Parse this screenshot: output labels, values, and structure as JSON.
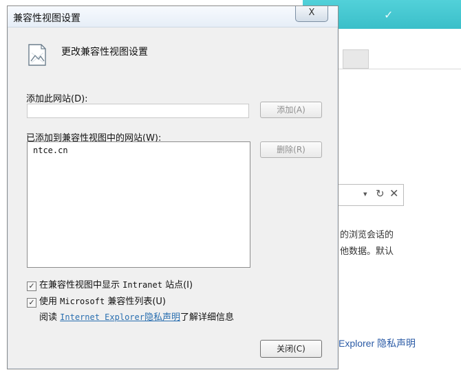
{
  "background_window": {
    "tail_text_1": "的浏览会话的",
    "tail_text_2": "他数据。默认",
    "privacy_text": "Explorer 隐私声明",
    "combo_dropdown": "▾",
    "combo_refresh": "C",
    "combo_close": "✕"
  },
  "dialog": {
    "title": "兼容性视图设置",
    "close_glyph": "X",
    "header": "更改兼容性视图设置",
    "add_site_label": "添加此网站(D):",
    "add_site_value": "",
    "add_button": "添加(A)",
    "list_label": "已添加到兼容性视图中的网站(W):",
    "sites": [
      "ntce.cn"
    ],
    "remove_button": "删除(R)",
    "show_intranet_prefix": "在兼容性视图中显示",
    "show_intranet_word": "Intranet",
    "show_intranet_suffix": "站点(I)",
    "show_intranet_checked": true,
    "use_ms_prefix": "使用",
    "use_ms_word": "Microsoft",
    "use_ms_suffix": "兼容性列表(U)",
    "use_ms_checked": true,
    "read_prefix": "阅读",
    "read_link_en": "Internet Explorer",
    "read_link_cn": "隐私声明",
    "read_suffix": "了解详细信息",
    "close_button": "关闭(C)"
  },
  "colors": {
    "accent_teal": "#3bbfc9",
    "link_blue": "#2a6fb0"
  }
}
